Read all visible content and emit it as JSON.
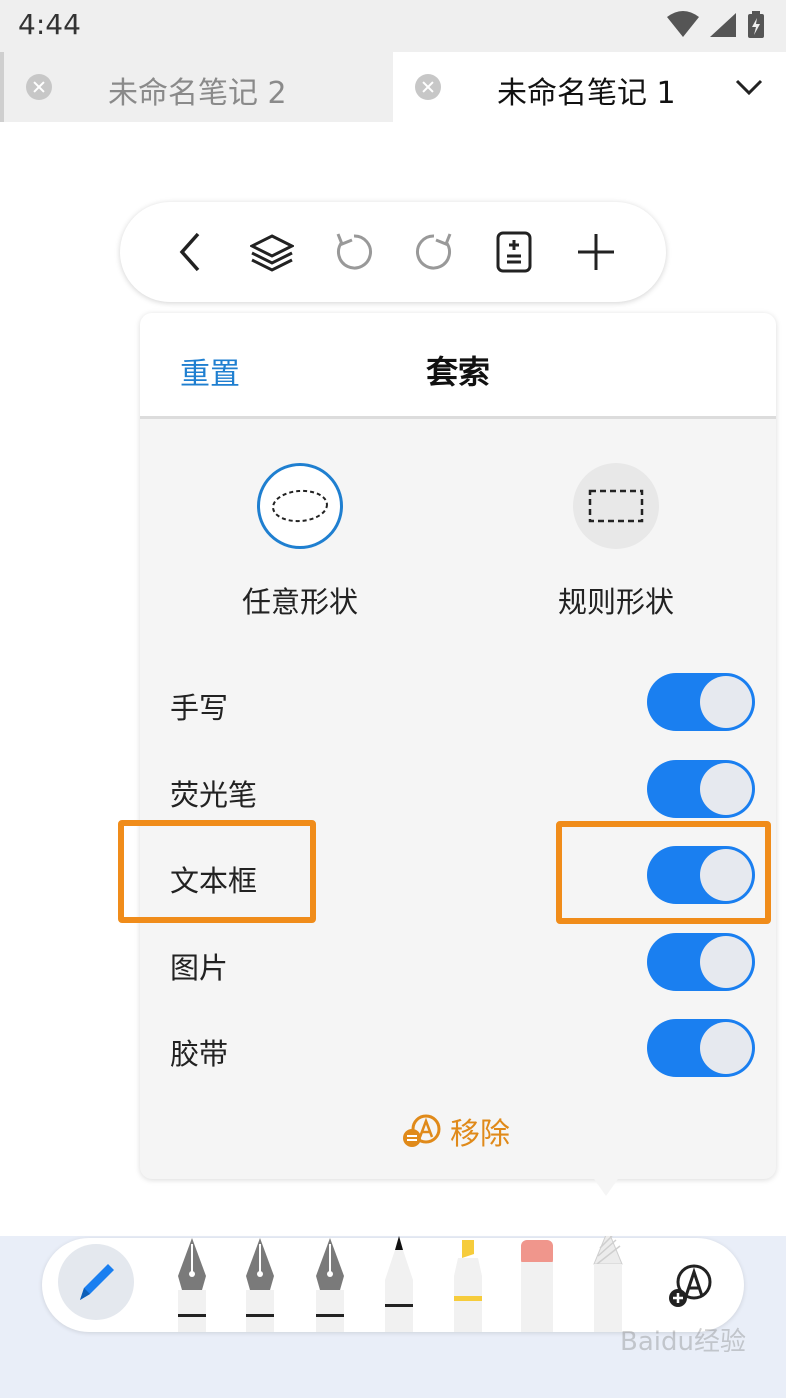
{
  "status_bar": {
    "time": "4:44"
  },
  "tabs": [
    {
      "title": "未命名笔记 2",
      "active": false
    },
    {
      "title": "未命名笔记 1",
      "active": true
    }
  ],
  "toolbar": {
    "buttons": [
      "back-icon",
      "layers-icon",
      "undo-icon",
      "redo-icon",
      "page-settings-icon",
      "add-icon"
    ]
  },
  "lasso_panel": {
    "reset_label": "重置",
    "title": "套索",
    "modes": [
      {
        "label": "任意形状",
        "selected": true
      },
      {
        "label": "规则形状",
        "selected": false
      }
    ],
    "options": [
      {
        "label": "手写",
        "enabled": true
      },
      {
        "label": "荧光笔",
        "enabled": true
      },
      {
        "label": "文本框",
        "enabled": true
      },
      {
        "label": "图片",
        "enabled": true
      },
      {
        "label": "胶带",
        "enabled": true
      }
    ],
    "remove_label": "移除"
  },
  "colors": {
    "accent_blue": "#1a7ff0",
    "link_blue": "#1f7fd0",
    "highlight_orange": "#f08c1a",
    "remove_orange": "#e08a1a"
  },
  "dock": {
    "tools": [
      "pencil-icon",
      "fountain-pen-icon",
      "fountain-pen-icon",
      "fountain-pen-icon",
      "fineliner-icon",
      "highlighter-icon",
      "eraser-icon",
      "lasso-tool-icon",
      "shapes-icon"
    ]
  },
  "watermark": "Baidu经验"
}
